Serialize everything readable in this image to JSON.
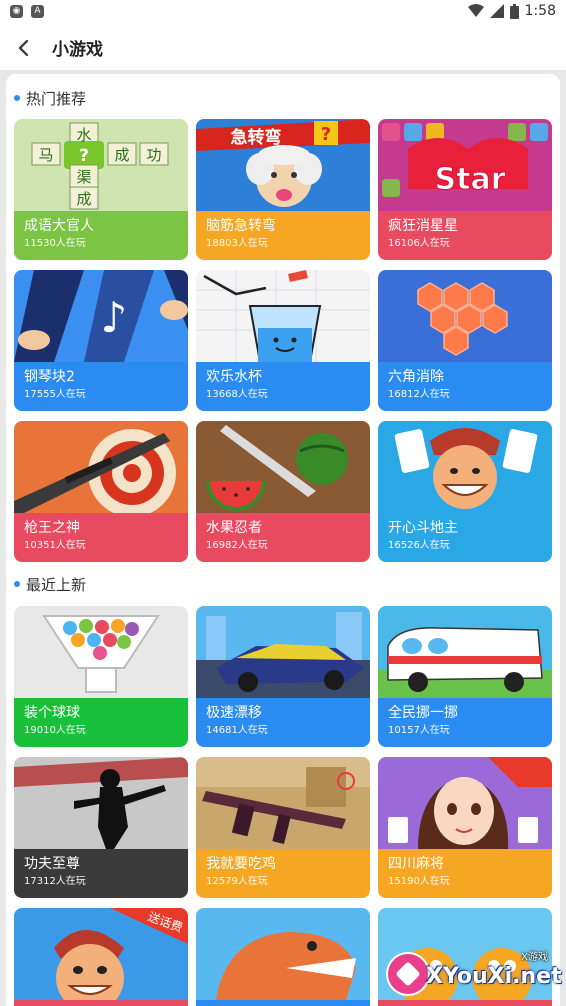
{
  "status_bar": {
    "time": "1:58",
    "left_icons": [
      "messenger-icon",
      "a-icon"
    ]
  },
  "header": {
    "title": "小游戏",
    "back_icon": "arrow-left-icon"
  },
  "sections": [
    {
      "title": "热门推荐",
      "games": [
        {
          "name": "成语大官人",
          "players": "11530人在玩",
          "color": "#7cc444",
          "thumb_text": [
            "水",
            "马",
            "?",
            "成",
            "功",
            "渠",
            "成"
          ]
        },
        {
          "name": "脑筋急转弯",
          "players": "18803人在玩",
          "color": "#f5a623",
          "thumb_text": [
            "急转弯",
            "?"
          ]
        },
        {
          "name": "疯狂消星星",
          "players": "16106人在玩",
          "color": "#e84a5f",
          "thumb_text": [
            "Star"
          ]
        },
        {
          "name": "钢琴块2",
          "players": "17555人在玩",
          "color": "#2a8cf0"
        },
        {
          "name": "欢乐水杯",
          "players": "13668人在玩",
          "color": "#2a8cf0"
        },
        {
          "name": "六角消除",
          "players": "16812人在玩",
          "color": "#2a8cf0"
        },
        {
          "name": "枪王之神",
          "players": "10351人在玩",
          "color": "#e84a5f"
        },
        {
          "name": "水果忍者",
          "players": "16982人在玩",
          "color": "#e84a5f"
        },
        {
          "name": "开心斗地主",
          "players": "16526人在玩",
          "color": "#2aa8e6"
        }
      ]
    },
    {
      "title": "最近上新",
      "games": [
        {
          "name": "装个球球",
          "players": "19010人在玩",
          "color": "#19c03a"
        },
        {
          "name": "极速漂移",
          "players": "14681人在玩",
          "color": "#2a8cf0"
        },
        {
          "name": "全民挪一挪",
          "players": "10157人在玩",
          "color": "#2a8cf0"
        },
        {
          "name": "功夫至尊",
          "players": "17312人在玩",
          "color": "#3a3a3a"
        },
        {
          "name": "我就要吃鸡",
          "players": "12579人在玩",
          "color": "#f5a623"
        },
        {
          "name": "四川麻将",
          "players": "15190人在玩",
          "color": "#f5a623"
        },
        {
          "name": "",
          "players": "",
          "color": "#e84a5f",
          "thumb_text": [
            "送话费"
          ]
        },
        {
          "name": "",
          "players": "",
          "color": "#2a8cf0"
        },
        {
          "name": "",
          "players": "",
          "color": "#e84a5f"
        }
      ]
    }
  ],
  "watermark": {
    "text": "XYouXi.net",
    "small": "X游戏"
  }
}
